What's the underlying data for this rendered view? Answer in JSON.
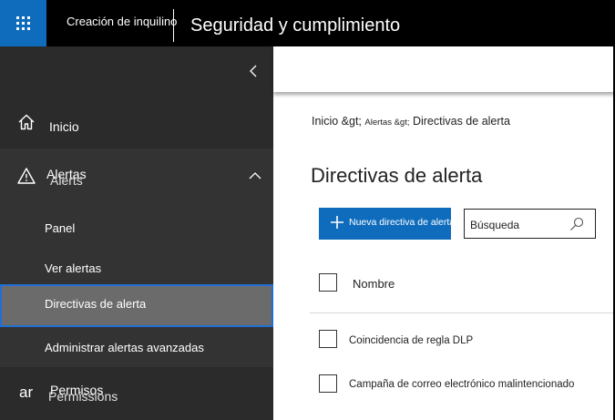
{
  "topbar": {
    "tenant": "Creación de inquilino",
    "app_title": "Seguridad y cumplimiento"
  },
  "sidebar": {
    "home_label": "Inicio",
    "alerts_label": "Alertas",
    "alerts_ghost": "Alerts",
    "items": [
      {
        "label": "Panel"
      },
      {
        "label": "Ver alertas"
      },
      {
        "label": "Directivas de alerta"
      },
      {
        "label": "Administrar alertas avanzadas"
      }
    ],
    "permissions_icon_text": "ar",
    "permissions_label": "Permisos",
    "permissions_ghost": "Permissions"
  },
  "breadcrumb": {
    "home": "Inicio &gt;",
    "alerts": "Alertas &gt;",
    "current": "Directivas de alerta"
  },
  "page": {
    "title": "Directivas de alerta",
    "new_button": "Nueva directiva de alerta",
    "search_placeholder": "Búsqueda"
  },
  "table": {
    "header": "Nombre",
    "rows": [
      {
        "name": "Coincidencia de regla DLP"
      },
      {
        "name": "Campaña de correo electrónico malintencionado"
      }
    ]
  },
  "colors": {
    "accent": "#0f6cbd",
    "topbar": "#000000",
    "sidebar": "#2b2b2b",
    "selected_item": "#6b6b6b"
  }
}
